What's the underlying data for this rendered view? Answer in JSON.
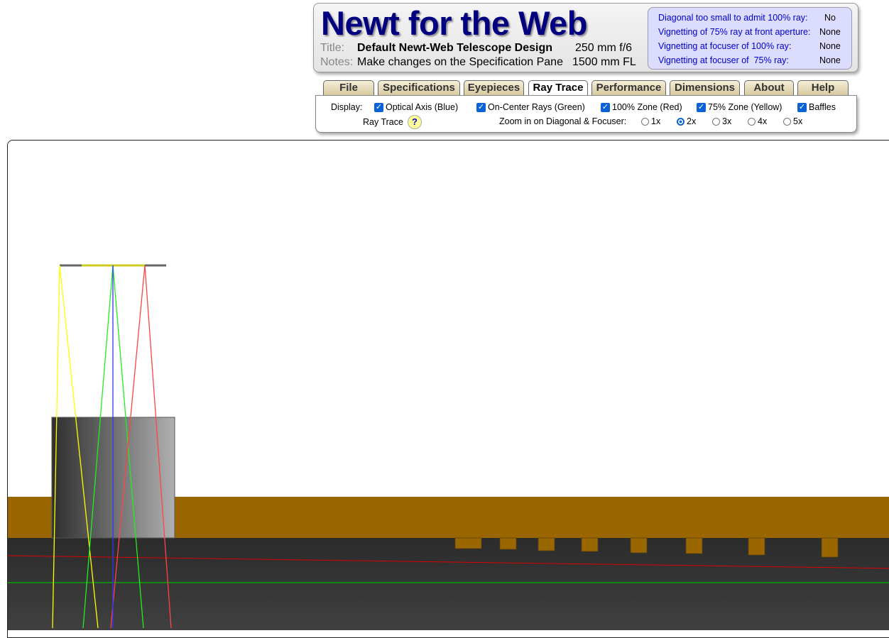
{
  "header": {
    "app_title": "Newt for the Web",
    "title_label": "Title:",
    "title_value": "Default Newt-Web Telescope Design",
    "aperture": "250 mm f/6",
    "notes_label": "Notes:",
    "notes_value": "Make changes on the Specification Pane",
    "focal_length": "1500 mm FL"
  },
  "status": [
    {
      "label": "Diagonal too small to admit 100% ray:",
      "value": "No"
    },
    {
      "label": "Vignetting of 75% ray at front aperture:",
      "value": "None"
    },
    {
      "label": "Vignetting at focuser of 100% ray:",
      "value": "None"
    },
    {
      "label": "Vignetting at focuser of  75% ray:",
      "value": "None"
    }
  ],
  "tabs": [
    {
      "label": "File"
    },
    {
      "label": "Specifications"
    },
    {
      "label": "Eyepieces"
    },
    {
      "label": "Ray Trace",
      "active": true
    },
    {
      "label": "Performance"
    },
    {
      "label": "Dimensions"
    },
    {
      "label": "About"
    },
    {
      "label": "Help"
    }
  ],
  "display": {
    "label": "Display:",
    "options": [
      {
        "label": "Optical Axis (Blue)",
        "checked": true
      },
      {
        "label": "On-Center Rays (Green)",
        "checked": true
      },
      {
        "label": "100% Zone (Red)",
        "checked": true
      },
      {
        "label": "75% Zone (Yellow)",
        "checked": true
      },
      {
        "label": "Baffles",
        "checked": true
      }
    ]
  },
  "raytrace_label": "Ray Trace",
  "help_icon": "?",
  "zoom": {
    "label": "Zoom in on Diagonal & Focuser:",
    "options": [
      "1x",
      "2x",
      "3x",
      "4x",
      "5x"
    ],
    "selected": "2x"
  },
  "colors": {
    "title": "#000080",
    "tube": "#996600",
    "axis": "#0000ff",
    "on_center": "#00dd00",
    "zone100": "#ff3333",
    "zone75": "#ffff00"
  }
}
